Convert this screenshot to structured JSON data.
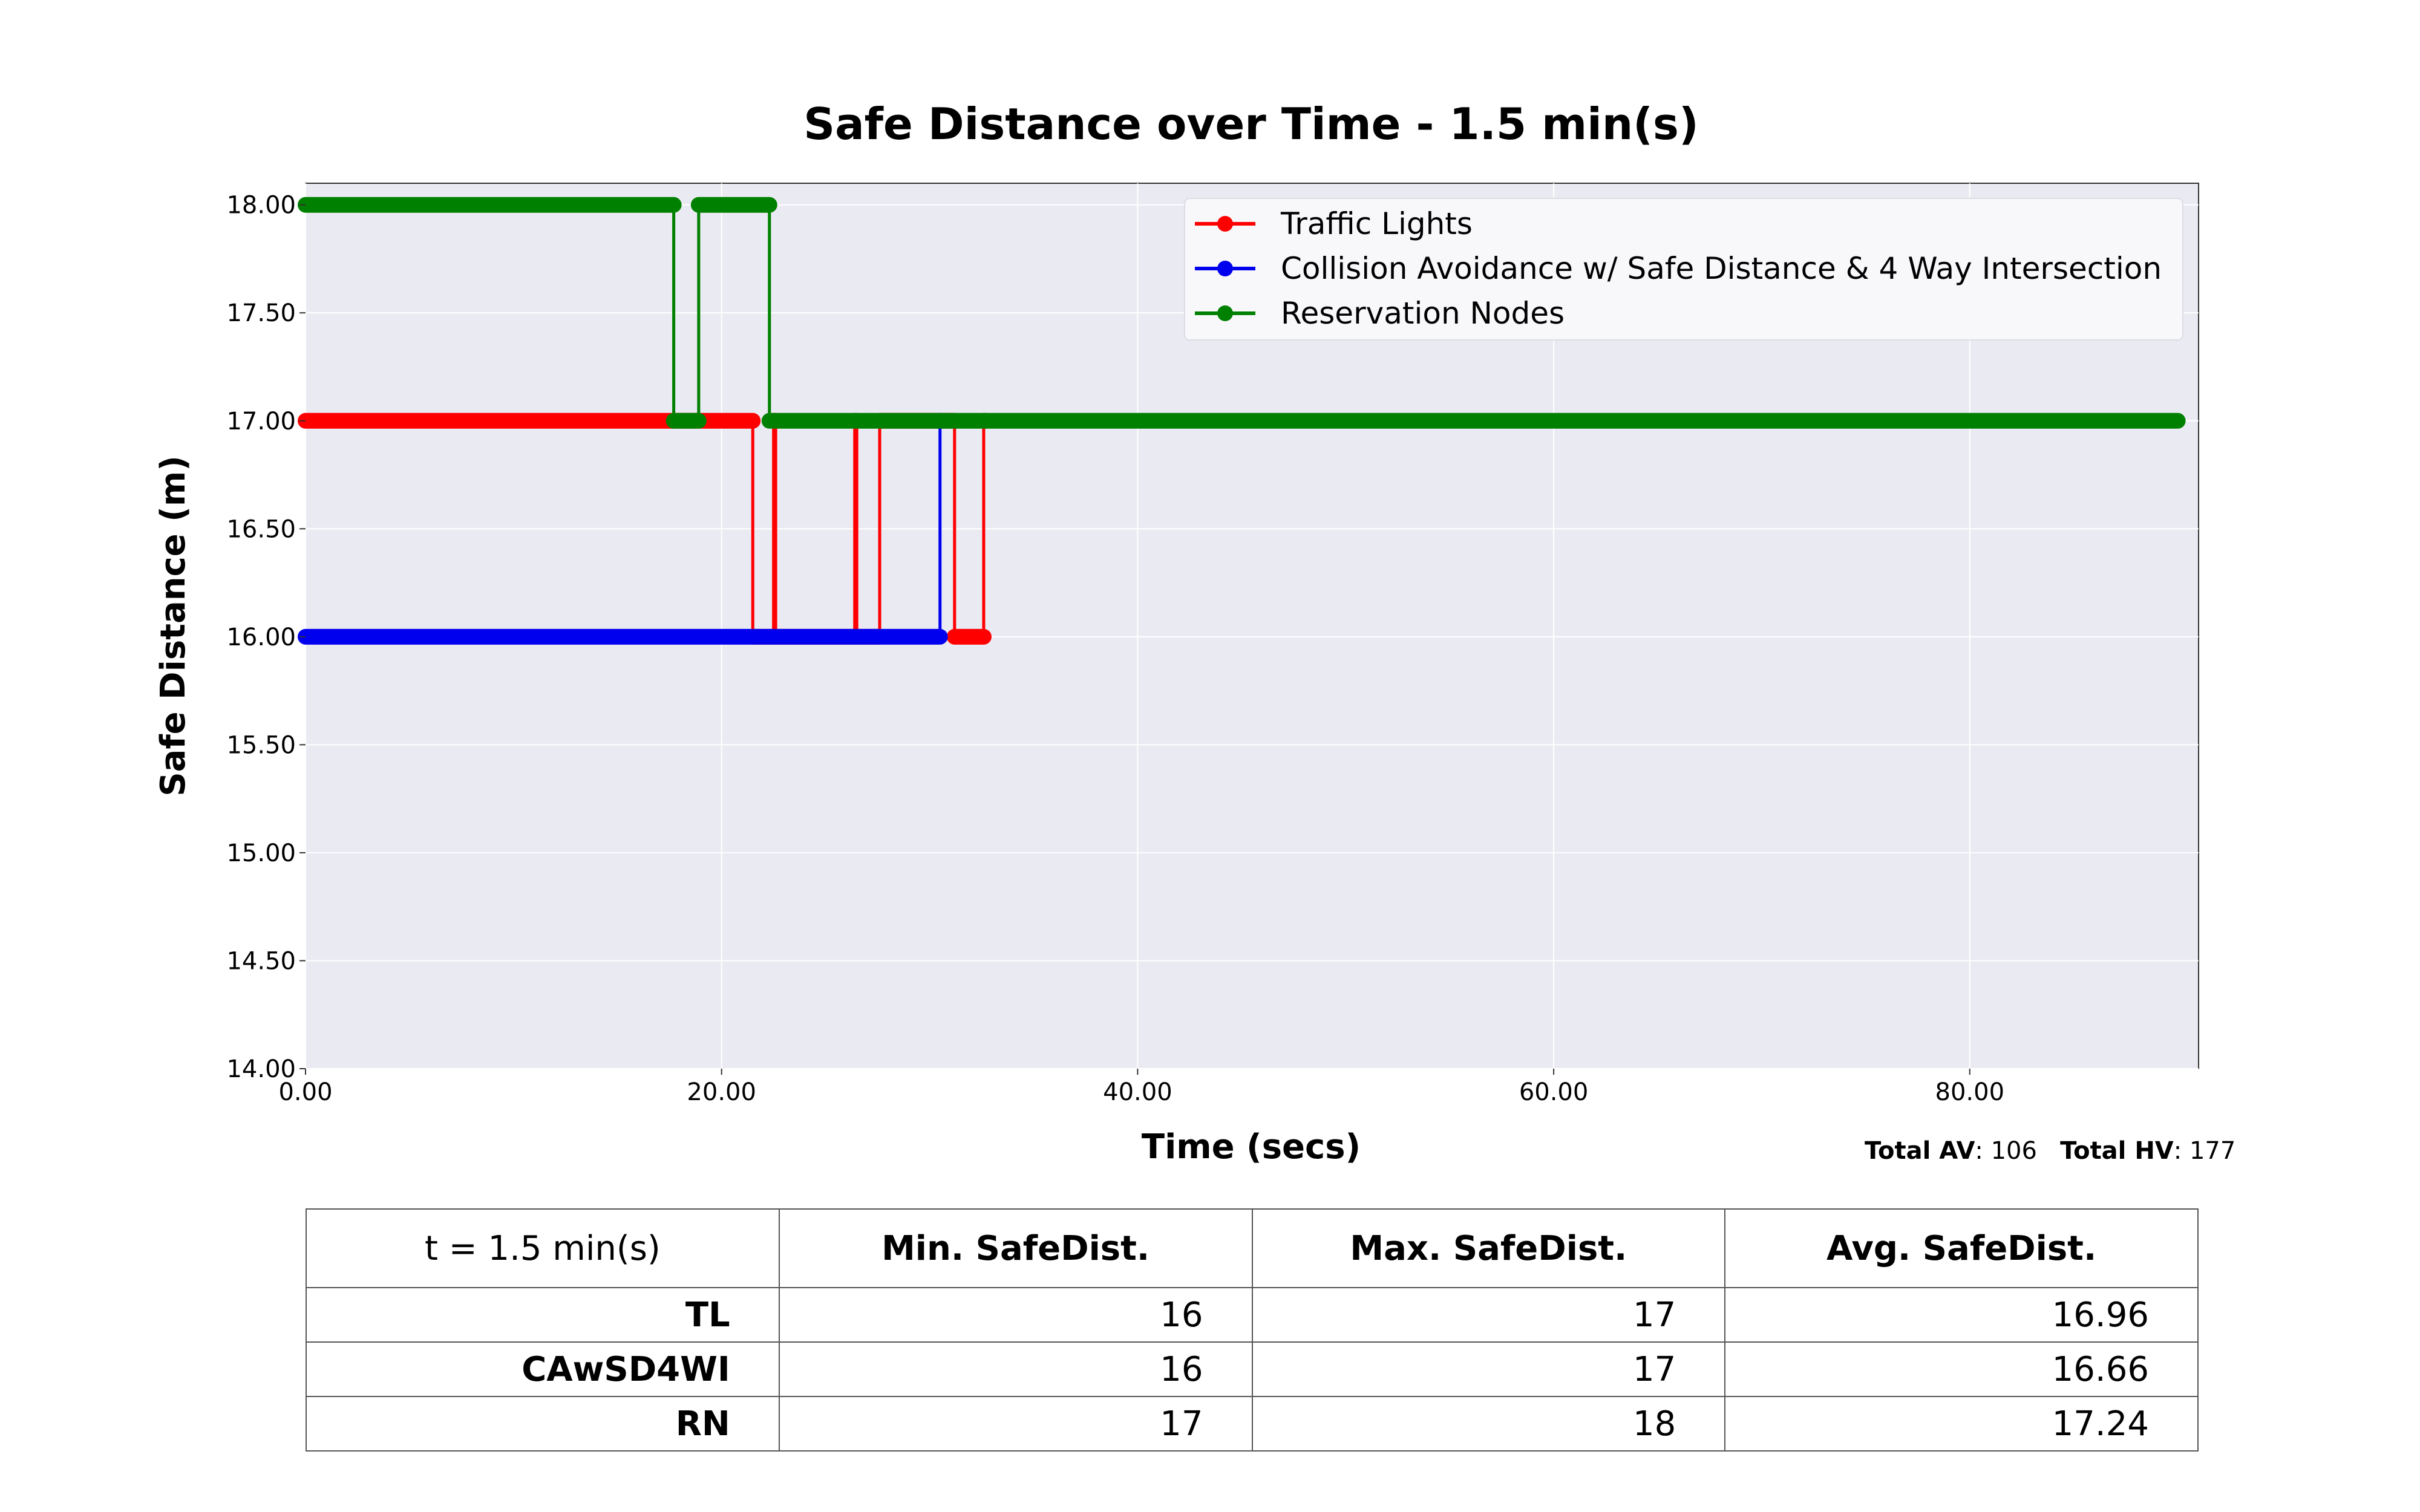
{
  "chart_data": {
    "type": "line",
    "title": "Safe Distance over Time - 1.5 min(s)",
    "xlabel": "Time (secs)",
    "ylabel": "Safe Distance (m)",
    "xlim": [
      0,
      91
    ],
    "ylim": [
      14,
      18.1
    ],
    "x_ticks": [
      "0.00",
      "20.00",
      "40.00",
      "60.00",
      "80.00"
    ],
    "y_ticks": [
      "14.00",
      "14.50",
      "15.00",
      "15.50",
      "16.00",
      "16.50",
      "17.00",
      "17.50",
      "18.00"
    ],
    "grid": true,
    "legend_position": "top-right",
    "series": [
      {
        "name": "Traffic Lights",
        "color": "#ff0000",
        "segments": [
          [
            [
              0,
              17
            ],
            [
              21.5,
              17
            ]
          ],
          [
            [
              21.5,
              16
            ],
            [
              22.5,
              16
            ]
          ],
          [
            [
              22.5,
              17
            ],
            [
              22.6,
              17
            ]
          ],
          [
            [
              22.6,
              16
            ],
            [
              26.4,
              16
            ]
          ],
          [
            [
              26.4,
              17
            ],
            [
              26.5,
              17
            ]
          ],
          [
            [
              26.5,
              16
            ],
            [
              27.6,
              16
            ]
          ],
          [
            [
              27.6,
              17
            ],
            [
              31.2,
              17
            ]
          ],
          [
            [
              31.2,
              16
            ],
            [
              32.6,
              16
            ]
          ],
          [
            [
              32.6,
              17
            ],
            [
              32.7,
              17
            ]
          ]
        ],
        "x": [
          0,
          21.5,
          21.5,
          22.5,
          22.5,
          22.6,
          22.6,
          26.4,
          26.4,
          26.5,
          26.5,
          27.6,
          27.6,
          31.2,
          31.2,
          32.6,
          32.6,
          32.7
        ],
        "y": [
          17,
          17,
          16,
          16,
          17,
          17,
          16,
          16,
          17,
          17,
          16,
          16,
          17,
          17,
          16,
          16,
          17,
          17
        ]
      },
      {
        "name": "Collision Avoidance w/ Safe Distance & 4 Way Intersection",
        "color": "#0000ee",
        "segments": [
          [
            [
              0,
              16
            ],
            [
              30.5,
              16
            ]
          ],
          [
            [
              30.5,
              17
            ],
            [
              30.6,
              17
            ]
          ]
        ],
        "x": [
          0,
          30.5,
          30.5,
          30.6
        ],
        "y": [
          16,
          16,
          17,
          17
        ]
      },
      {
        "name": "Reservation Nodes",
        "color": "#008000",
        "segments": [
          [
            [
              0,
              18
            ],
            [
              17.7,
              18
            ]
          ],
          [
            [
              17.7,
              17
            ],
            [
              18.9,
              17
            ]
          ],
          [
            [
              18.9,
              18
            ],
            [
              22.3,
              18
            ]
          ],
          [
            [
              22.3,
              17
            ],
            [
              90,
              17
            ]
          ]
        ],
        "x": [
          0,
          17.7,
          17.7,
          18.9,
          18.9,
          22.3,
          22.3,
          90
        ],
        "y": [
          18,
          18,
          17,
          17,
          18,
          18,
          17,
          17
        ]
      }
    ]
  },
  "totals": {
    "av_label": "Total AV",
    "av_value": ": 106",
    "hv_label": "Total HV",
    "hv_value": ": 177"
  },
  "table": {
    "corner": "t = 1.5 min(s)",
    "headers": [
      "Min. SafeDist.",
      "Max. SafeDist.",
      "Avg. SafeDist."
    ],
    "rows": [
      {
        "label": "TL",
        "min": "16",
        "max": "17",
        "avg": "16.96"
      },
      {
        "label": "CAwSD4WI",
        "min": "16",
        "max": "17",
        "avg": "16.66"
      },
      {
        "label": "RN",
        "min": "17",
        "max": "18",
        "avg": "17.24"
      }
    ]
  }
}
